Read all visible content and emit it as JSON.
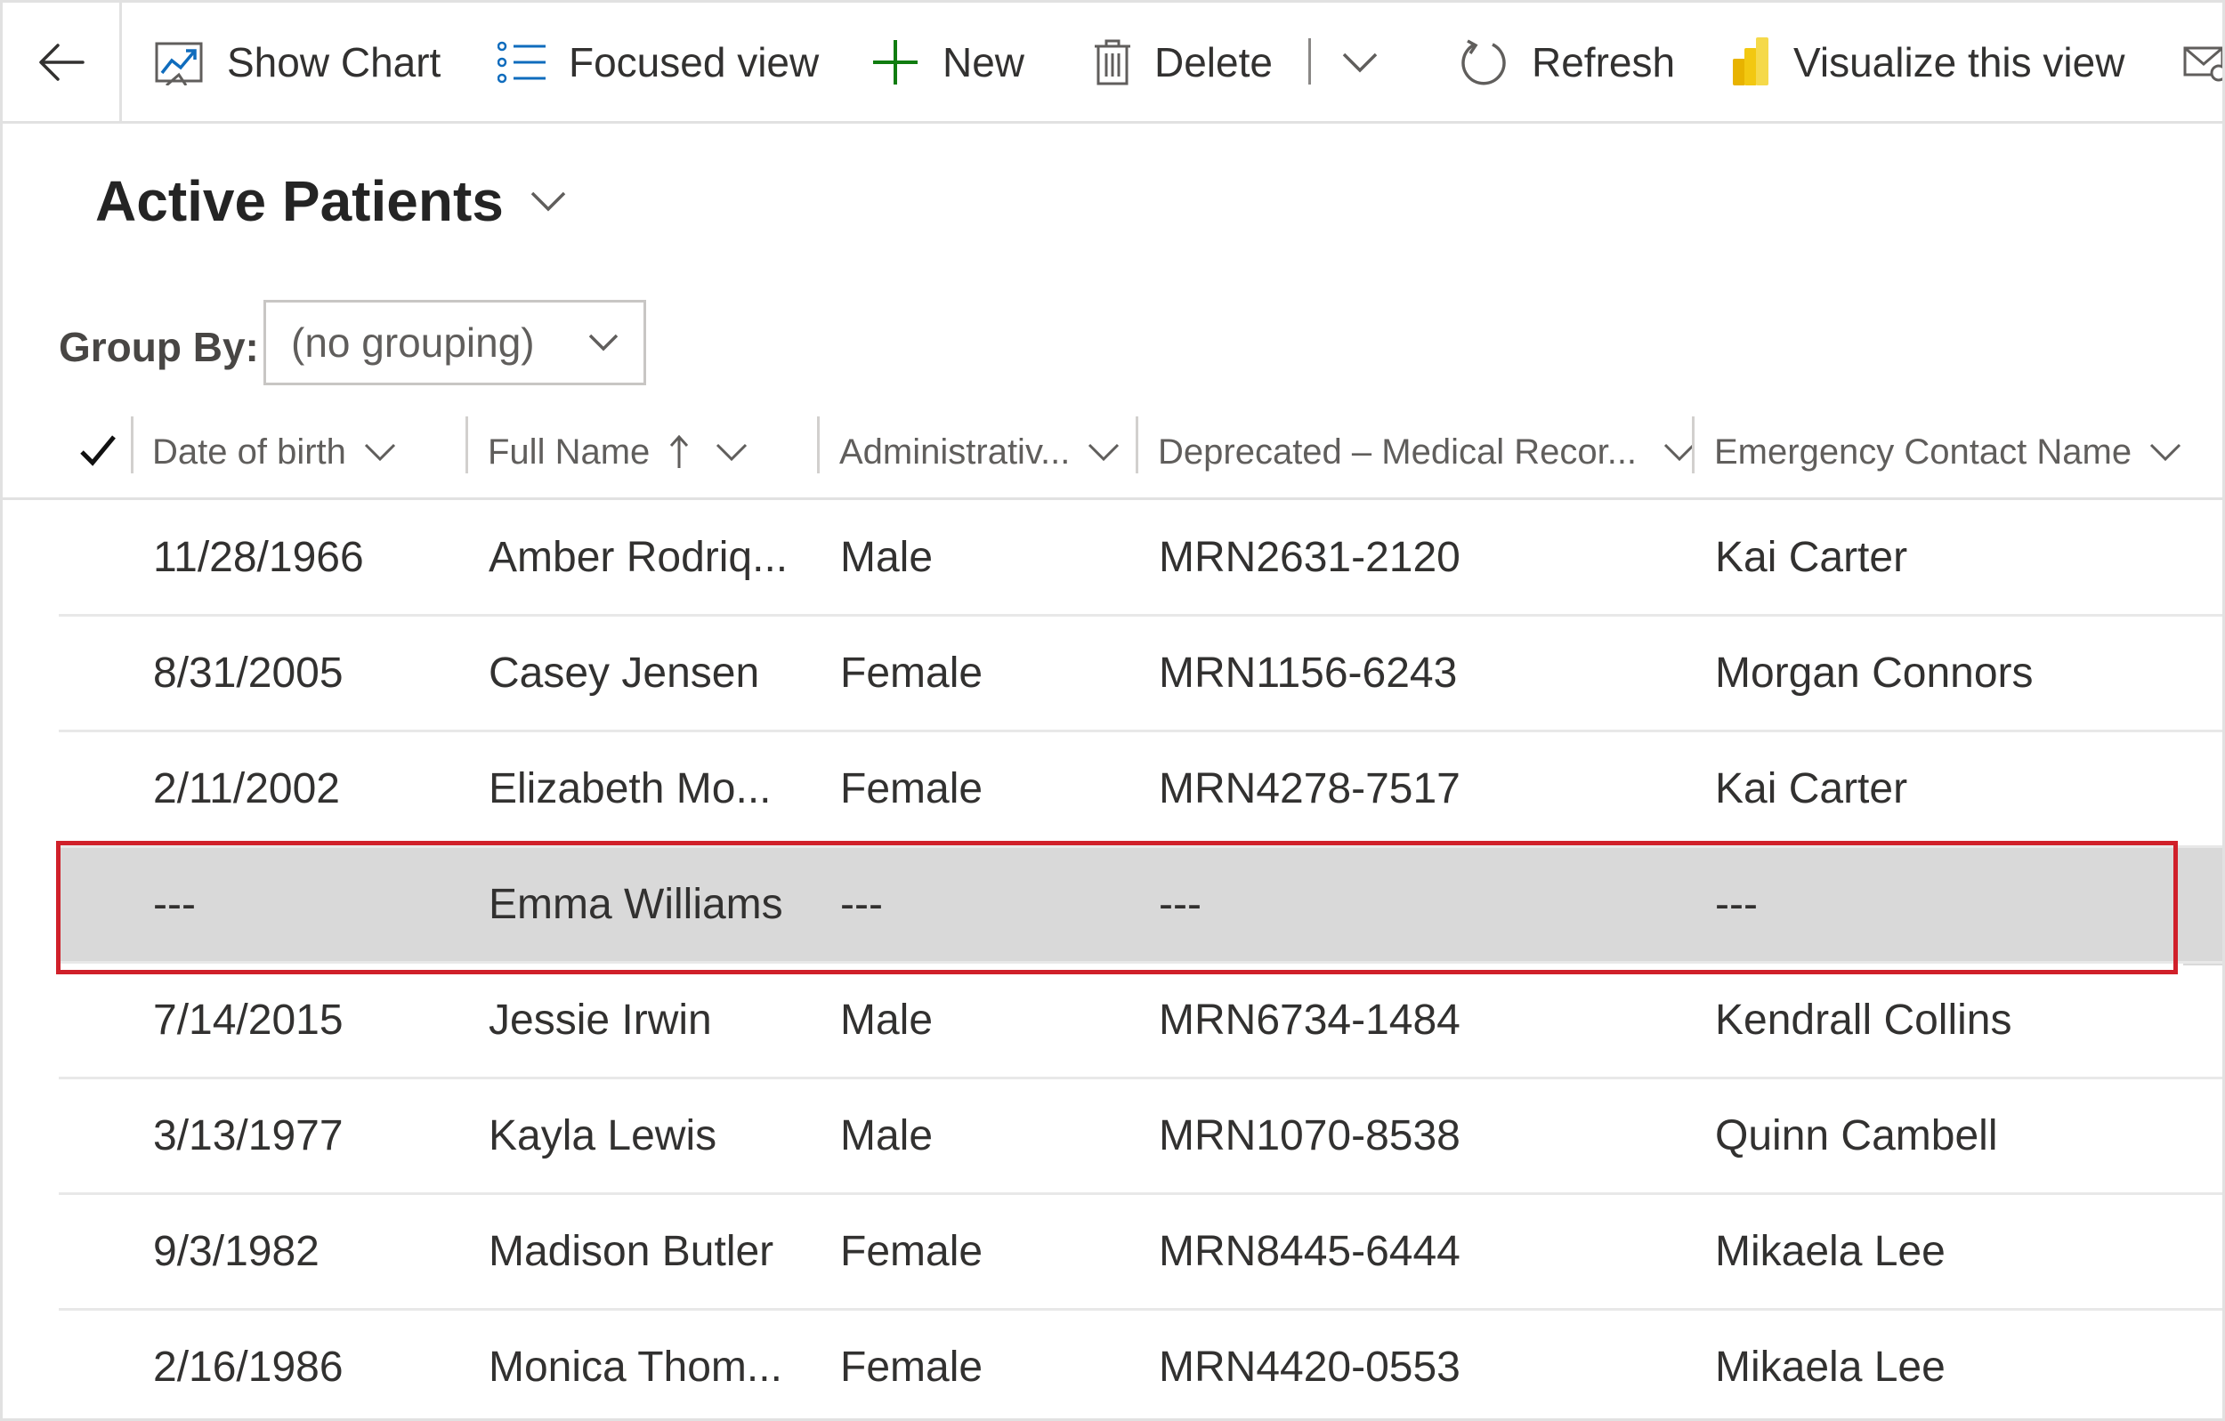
{
  "command_bar": {
    "show_chart": "Show Chart",
    "focused_view": "Focused view",
    "new": "New",
    "delete": "Delete",
    "refresh": "Refresh",
    "visualize": "Visualize this view"
  },
  "view": {
    "title": "Active Patients"
  },
  "group_by": {
    "label": "Group By:",
    "value": "(no grouping)"
  },
  "columns": [
    "Date of birth",
    "Full Name",
    "Administrativ...",
    "Deprecated – Medical Recor...",
    "Emergency Contact Name"
  ],
  "rows": [
    {
      "dob": "11/28/1966",
      "name": "Amber Rodriq...",
      "admin": "Male",
      "mrn": "MRN2631-2120",
      "contact": "Kai Carter"
    },
    {
      "dob": "8/31/2005",
      "name": "Casey Jensen",
      "admin": "Female",
      "mrn": "MRN1156-6243",
      "contact": "Morgan Connors"
    },
    {
      "dob": "2/11/2002",
      "name": "Elizabeth Mo...",
      "admin": "Female",
      "mrn": "MRN4278-7517",
      "contact": "Kai Carter"
    },
    {
      "dob": "---",
      "name": "Emma Williams",
      "admin": "---",
      "mrn": "---",
      "contact": "---"
    },
    {
      "dob": "7/14/2015",
      "name": "Jessie Irwin",
      "admin": "Male",
      "mrn": "MRN6734-1484",
      "contact": "Kendrall Collins"
    },
    {
      "dob": "3/13/1977",
      "name": "Kayla Lewis",
      "admin": "Male",
      "mrn": "MRN1070-8538",
      "contact": "Quinn Cambell"
    },
    {
      "dob": "9/3/1982",
      "name": "Madison Butler",
      "admin": "Female",
      "mrn": "MRN8445-6444",
      "contact": "Mikaela Lee"
    },
    {
      "dob": "2/16/1986",
      "name": "Monica Thom...",
      "admin": "Female",
      "mrn": "MRN4420-0553",
      "contact": "Mikaela Lee"
    }
  ],
  "colors": {
    "accent_blue": "#0f6cbd",
    "new_green": "#107c10",
    "highlight_red": "#d0202a",
    "highlight_row": "#d9d9d9",
    "powerbi_yellow": "#f2c811"
  },
  "icons": {
    "back": "back-arrow-icon",
    "show_chart": "chart-icon",
    "focused_view": "list-icon",
    "new": "plus-icon",
    "delete": "trash-icon",
    "refresh": "refresh-icon",
    "visualize": "powerbi-icon",
    "email_link": "email-link-icon"
  }
}
